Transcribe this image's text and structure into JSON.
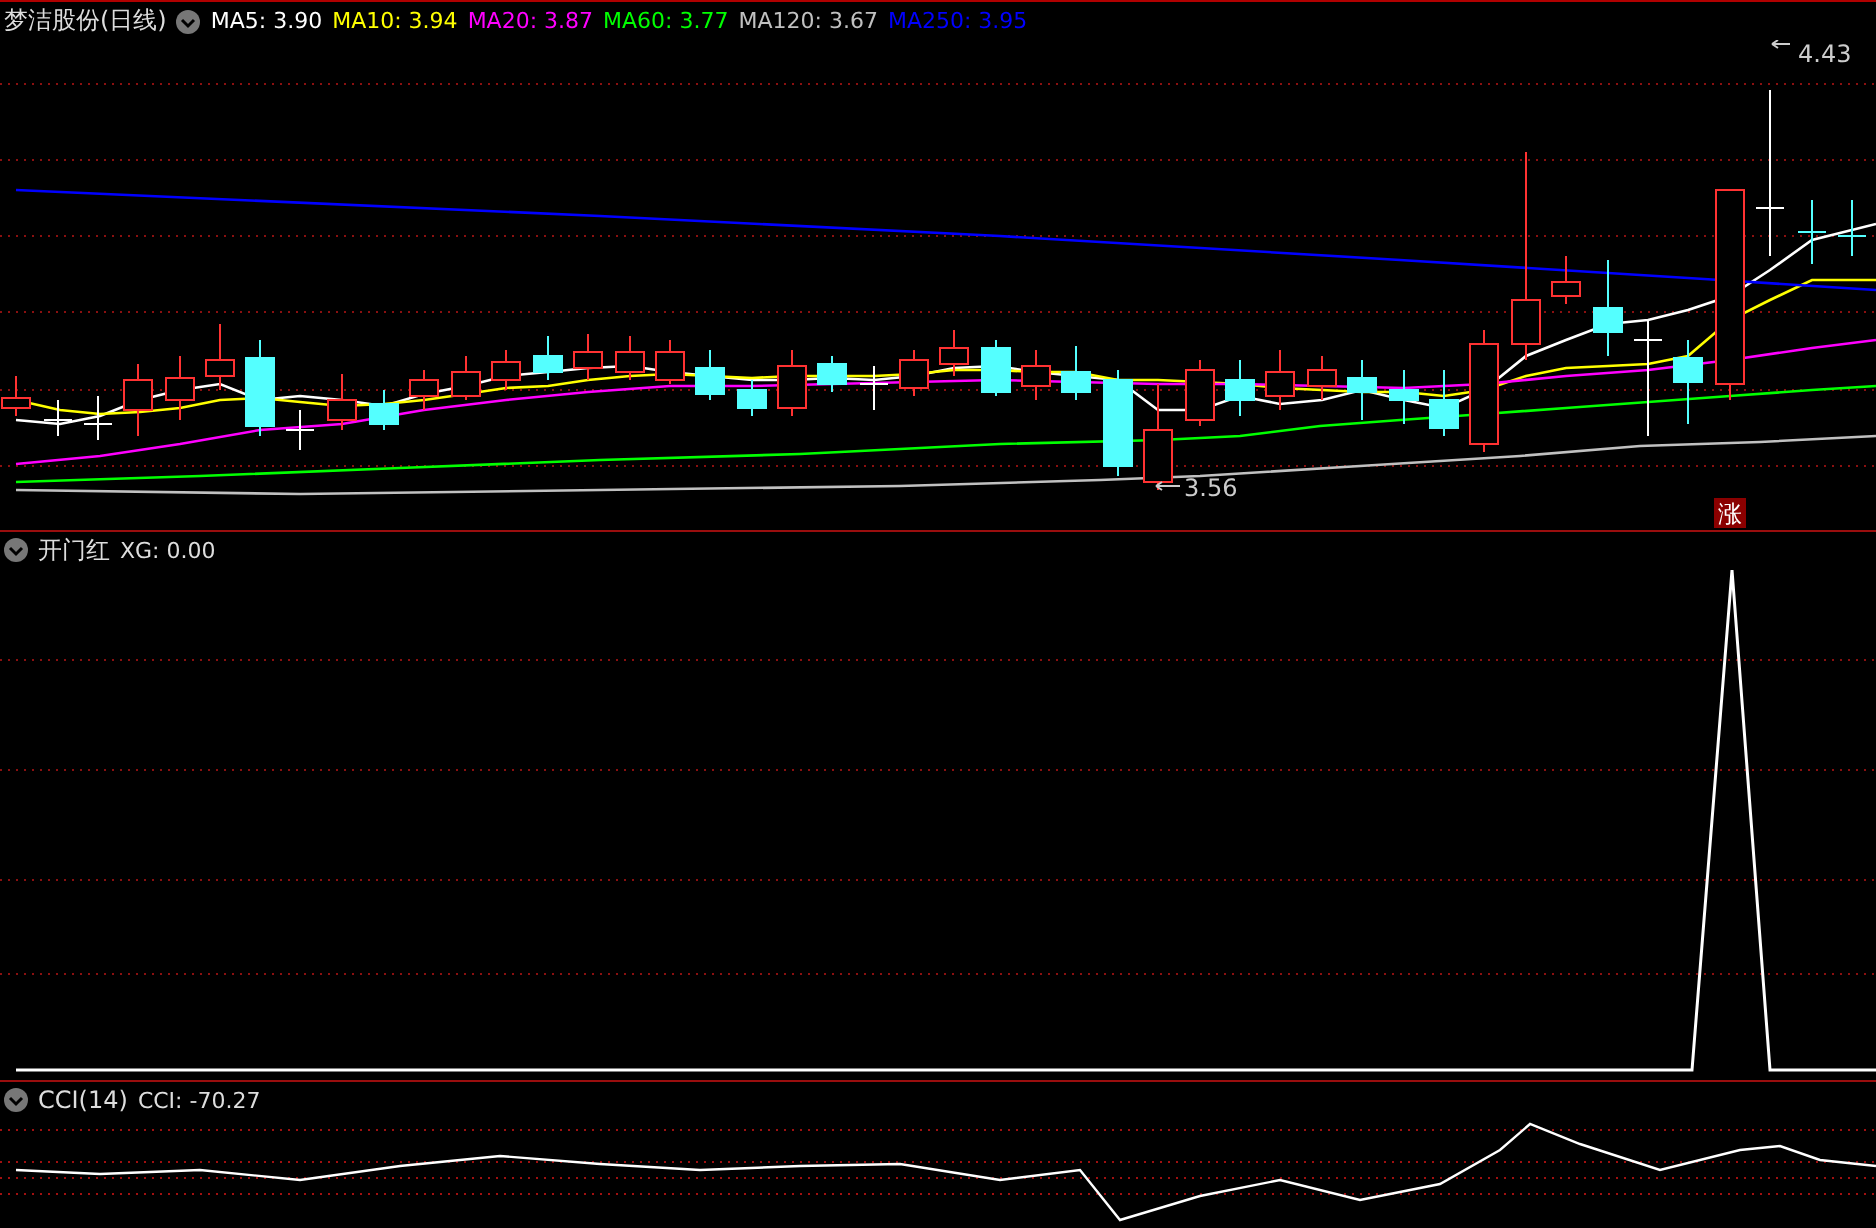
{
  "price_panel": {
    "title": "梦洁股份(日线)",
    "indicators": [
      {
        "label": "MA5: 3.90",
        "color": "#ffffff"
      },
      {
        "label": "MA10: 3.94",
        "color": "#ffff00"
      },
      {
        "label": "MA20: 3.87",
        "color": "#ff00ff"
      },
      {
        "label": "MA60: 3.77",
        "color": "#00ff00"
      },
      {
        "label": "MA120: 3.67",
        "color": "#c0c0c0"
      },
      {
        "label": "MA250: 3.95",
        "color": "#0000ff"
      }
    ],
    "high_label": "4.43",
    "low_label": "3.56",
    "badge": "涨"
  },
  "signal_panel": {
    "title": "开门红",
    "reading": "XG: 0.00"
  },
  "cci_panel": {
    "title": "CCI(14)",
    "reading": "CCI: -70.27"
  }
}
